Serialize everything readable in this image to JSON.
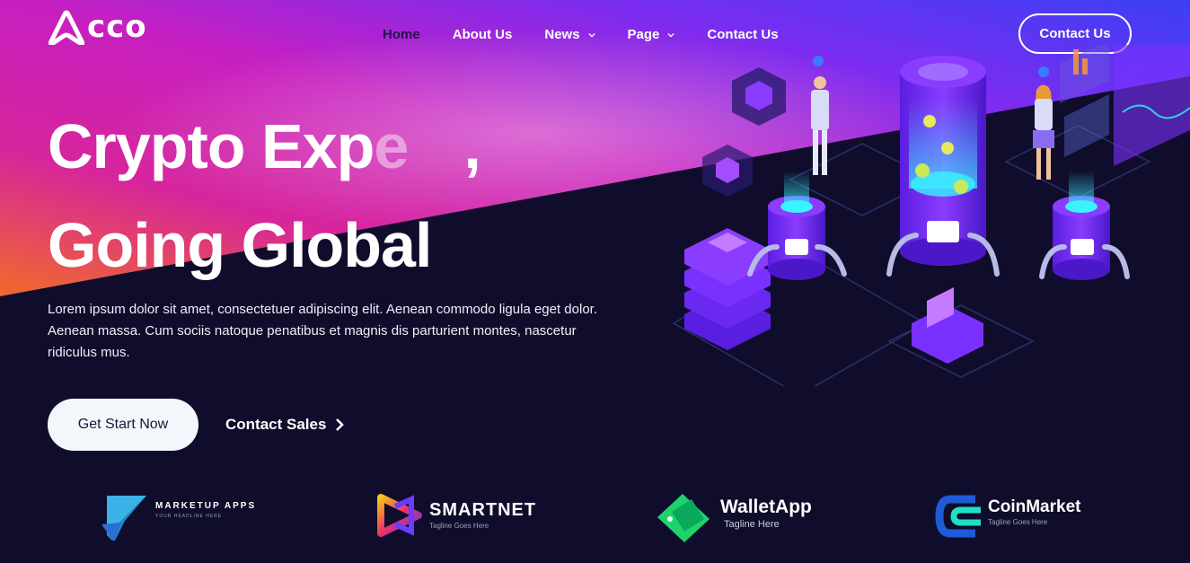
{
  "brand": {
    "logo_text": "cco"
  },
  "nav": {
    "items": [
      {
        "label": "Home"
      },
      {
        "label": "About Us"
      },
      {
        "label": "News"
      },
      {
        "label": "Page"
      },
      {
        "label": "Contact Us"
      }
    ],
    "cta_label": "Contact Us"
  },
  "hero": {
    "title_line1_start": "Crypto Exp",
    "title_line1_fade": "e",
    "title_line1_comma": ",",
    "title_line2": "Going Global",
    "description": "Lorem ipsum dolor sit amet, consectetuer adipiscing elit. Aenean commodo ligula eget dolor. Aenean massa. Cum sociis natoque penatibus et magnis dis parturient montes, nascetur ridiculus mus.",
    "primary_button": "Get Start Now",
    "secondary_link": "Contact Sales"
  },
  "partners": [
    {
      "name": "MARKETUP APPS",
      "tagline": "YOUR HEADLINE HERE"
    },
    {
      "name": "SMARTNET",
      "tagline": "Tagline Goes Here"
    },
    {
      "name": "WalletApp",
      "tagline": "Tagline Here"
    },
    {
      "name": "CoinMarket",
      "tagline": "Tagline Goes Here"
    }
  ],
  "colors": {
    "background": "#0f0d2b",
    "magenta": "#e01fa8",
    "violet": "#6b2cf5",
    "orange": "#f06a2a"
  }
}
